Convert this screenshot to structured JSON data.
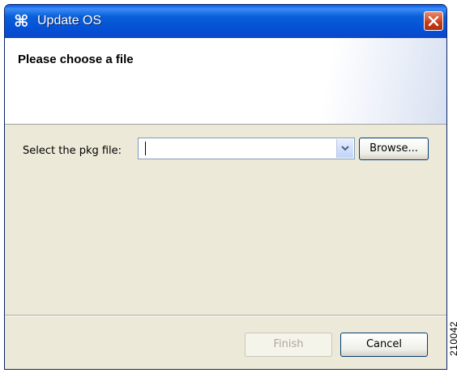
{
  "window": {
    "title": "Update OS",
    "title_icon": "⌘",
    "close_icon": "close-icon"
  },
  "banner": {
    "title": "Please choose a file"
  },
  "form": {
    "label": "Select the pkg file:",
    "value": "",
    "placeholder": ""
  },
  "buttons": {
    "browse": "Browse...",
    "finish": "Finish",
    "cancel": "Cancel"
  },
  "side_label": "210042",
  "colors": {
    "titlebar": "#0a58e5",
    "close": "#c63b19",
    "body": "#ece9d8",
    "disabled_text": "#aca899"
  }
}
